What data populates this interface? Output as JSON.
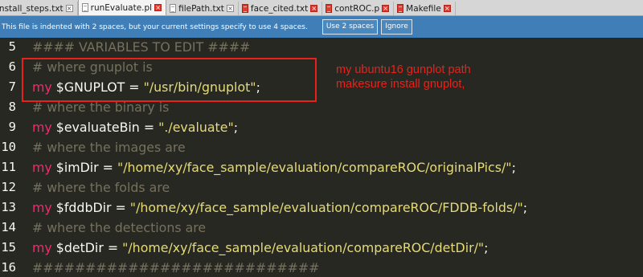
{
  "tabs": [
    {
      "name": "install_steps.txt",
      "icon": "text-file-icon",
      "modified": false
    },
    {
      "name": "runEvaluate.pl",
      "icon": "text-file-icon",
      "modified": true,
      "active": true
    },
    {
      "name": "filePath.txt",
      "icon": "text-file-icon",
      "modified": false
    },
    {
      "name": "face_cited.txt",
      "icon": "red-file-icon",
      "modified": true
    },
    {
      "name": "contROC.p",
      "icon": "red-file-icon",
      "modified": true
    },
    {
      "name": "Makefile",
      "icon": "red-file-icon",
      "modified": true
    }
  ],
  "notice": {
    "text": "This file is indented with 2 spaces, but your current settings specify to use 4 spaces.",
    "use_button": "Use 2 spaces",
    "ignore_button": "Ignore"
  },
  "lines": [
    {
      "num": "5",
      "parts": [
        {
          "t": "#### VARIABLES TO EDIT ####",
          "c": "cmt"
        }
      ]
    },
    {
      "num": "6",
      "parts": [
        {
          "t": "# where gnuplot is",
          "c": "cmt"
        }
      ]
    },
    {
      "num": "7",
      "parts": [
        {
          "t": "my",
          "c": "kw"
        },
        {
          "t": " $GNUPLOT = ",
          "c": "var"
        },
        {
          "t": "\"/usr/bin/gnuplot\"",
          "c": "str"
        },
        {
          "t": ";",
          "c": "var"
        }
      ]
    },
    {
      "num": "8",
      "parts": [
        {
          "t": "# where the binary is",
          "c": "cmt"
        }
      ]
    },
    {
      "num": "9",
      "parts": [
        {
          "t": "my",
          "c": "kw"
        },
        {
          "t": " $evaluateBin = ",
          "c": "var"
        },
        {
          "t": "\"./evaluate\"",
          "c": "str"
        },
        {
          "t": ";",
          "c": "var"
        }
      ]
    },
    {
      "num": "10",
      "parts": [
        {
          "t": "# where the images are",
          "c": "cmt"
        }
      ]
    },
    {
      "num": "11",
      "parts": [
        {
          "t": "my",
          "c": "kw"
        },
        {
          "t": " $imDir = ",
          "c": "var"
        },
        {
          "t": "\"/home/xy/face_sample/evaluation/compareROC/originalPics/\"",
          "c": "str"
        },
        {
          "t": ";",
          "c": "var"
        }
      ]
    },
    {
      "num": "12",
      "parts": [
        {
          "t": "# where the folds are",
          "c": "cmt"
        }
      ]
    },
    {
      "num": "13",
      "parts": [
        {
          "t": "my",
          "c": "kw"
        },
        {
          "t": " $fddbDir = ",
          "c": "var"
        },
        {
          "t": "\"/home/xy/face_sample/evaluation/compareROC/FDDB-folds/\"",
          "c": "str"
        },
        {
          "t": ";",
          "c": "var"
        }
      ]
    },
    {
      "num": "14",
      "parts": [
        {
          "t": "# where the detections are",
          "c": "cmt"
        }
      ]
    },
    {
      "num": "15",
      "parts": [
        {
          "t": "my",
          "c": "kw"
        },
        {
          "t": " $detDir = ",
          "c": "var"
        },
        {
          "t": "\"/home/xy/face_sample/evaluation/compareROC/detDir/\"",
          "c": "str"
        },
        {
          "t": ";",
          "c": "var"
        }
      ]
    },
    {
      "num": "16",
      "parts": [
        {
          "t": "###########################",
          "c": "cmt"
        }
      ]
    }
  ],
  "annotation": {
    "line1": "my ubuntu16 gunplot path",
    "line2": "makesure install gnuplot,"
  },
  "colors": {
    "background": "#272822",
    "keyword": "#f92672",
    "string": "#e6db74",
    "comment": "#75715e",
    "annotation": "#e8221b",
    "notice_bar": "#3f7eb7"
  }
}
